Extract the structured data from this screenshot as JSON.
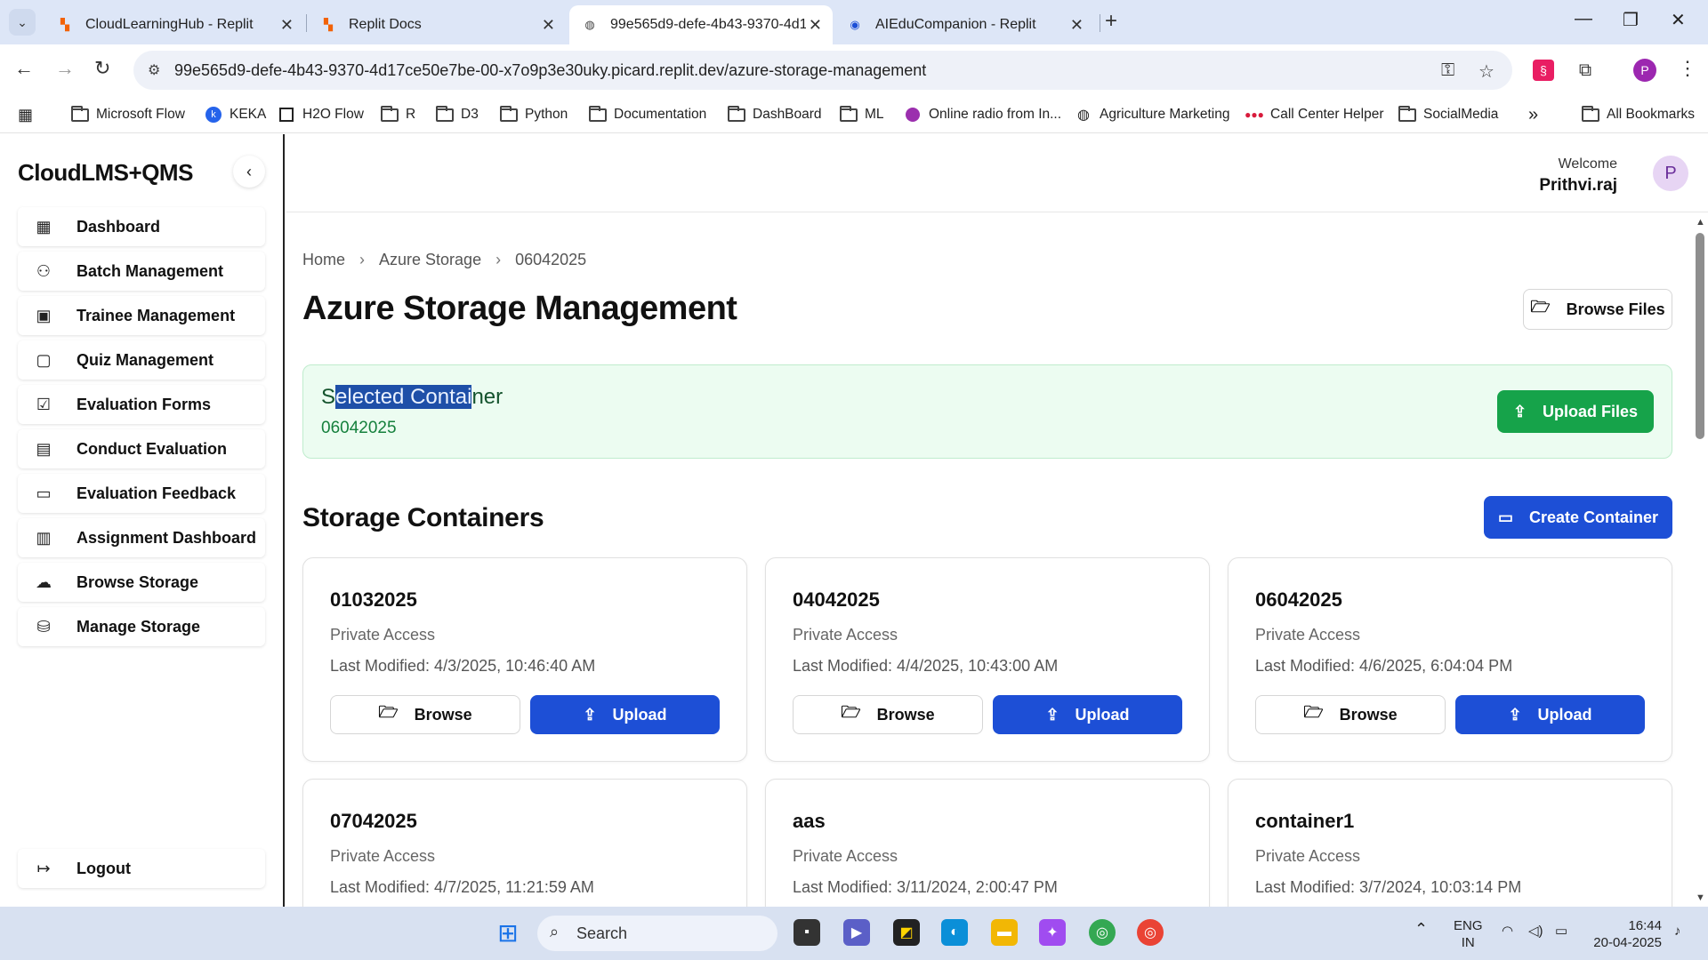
{
  "browser": {
    "tabs": [
      {
        "title": "CloudLearningHub - Replit",
        "active": false
      },
      {
        "title": "Replit Docs",
        "active": false
      },
      {
        "title": "99e565d9-defe-4b43-9370-4d1",
        "active": true
      },
      {
        "title": "AIEduCompanion - Replit",
        "active": false
      }
    ],
    "url": "99e565d9-defe-4b43-9370-4d17ce50e7be-00-x7o9p3e30uky.picard.replit.dev/azure-storage-management",
    "profile_initial": "P",
    "bookmarks": [
      {
        "label": "Microsoft Flow",
        "icon": "folder-icon"
      },
      {
        "label": "KEKA",
        "icon": "keka-icon"
      },
      {
        "label": "H2O Flow",
        "icon": "h2o-icon"
      },
      {
        "label": "R",
        "icon": "folder-icon"
      },
      {
        "label": "D3",
        "icon": "folder-icon"
      },
      {
        "label": "Python",
        "icon": "folder-icon"
      },
      {
        "label": "Documentation",
        "icon": "folder-icon"
      },
      {
        "label": "DashBoard",
        "icon": "folder-icon"
      },
      {
        "label": "ML",
        "icon": "folder-icon"
      },
      {
        "label": "Online radio from In...",
        "icon": "radio-icon"
      },
      {
        "label": "Agriculture Marketing",
        "icon": "globe-icon"
      },
      {
        "label": "Call Center Helper",
        "icon": "dots-icon"
      },
      {
        "label": "SocialMedia",
        "icon": "folder-icon"
      }
    ],
    "all_bookmarks": "All Bookmarks",
    "more_bookmarks": "»"
  },
  "app": {
    "brand": "CloudLMS+QMS",
    "collapse_icon": "‹",
    "nav": [
      {
        "label": "Dashboard",
        "icon": "grid-icon",
        "glyph": "▦"
      },
      {
        "label": "Batch Management",
        "icon": "users-icon",
        "glyph": "⚇"
      },
      {
        "label": "Trainee Management",
        "icon": "clipboard-icon",
        "glyph": "▣"
      },
      {
        "label": "Quiz Management",
        "icon": "book-icon",
        "glyph": "▢"
      },
      {
        "label": "Evaluation Forms",
        "icon": "checkbox-icon",
        "glyph": "☑"
      },
      {
        "label": "Conduct Evaluation",
        "icon": "file-icon",
        "glyph": "▤"
      },
      {
        "label": "Evaluation Feedback",
        "icon": "message-icon",
        "glyph": "▭"
      },
      {
        "label": "Assignment Dashboard",
        "icon": "calendar-icon",
        "glyph": "▥"
      },
      {
        "label": "Browse Storage",
        "icon": "cloud-icon",
        "glyph": "☁"
      },
      {
        "label": "Manage Storage",
        "icon": "database-icon",
        "glyph": "⛁"
      }
    ],
    "logout": "Logout",
    "welcome_label": "Welcome",
    "user_name": "Prithvi.raj",
    "user_initial": "P"
  },
  "page": {
    "breadcrumb": [
      "Home",
      "Azure Storage",
      "06042025"
    ],
    "title": "Azure Storage Management",
    "browse_files": "Browse Files",
    "selected_label_pre": "S",
    "selected_label_hl": "elected Contai",
    "selected_label_post": "ner",
    "selected_value": "06042025",
    "upload_files": "Upload Files",
    "section_title": "Storage Containers",
    "create_container": "Create Container",
    "browse_label": "Browse",
    "upload_label": "Upload",
    "containers": [
      {
        "name": "01032025",
        "access": "Private Access",
        "modified": "Last Modified: 4/3/2025, 10:46:40 AM"
      },
      {
        "name": "04042025",
        "access": "Private Access",
        "modified": "Last Modified: 4/4/2025, 10:43:00 AM"
      },
      {
        "name": "06042025",
        "access": "Private Access",
        "modified": "Last Modified: 4/6/2025, 6:04:04 PM"
      },
      {
        "name": "07042025",
        "access": "Private Access",
        "modified": "Last Modified: 4/7/2025, 11:21:59 AM"
      },
      {
        "name": "aas",
        "access": "Private Access",
        "modified": "Last Modified: 3/11/2024, 2:00:47 PM"
      },
      {
        "name": "container1",
        "access": "Private Access",
        "modified": "Last Modified: 3/7/2024, 10:03:14 PM"
      }
    ]
  },
  "taskbar": {
    "search": "Search",
    "lang1": "ENG",
    "lang2": "IN",
    "time": "16:44",
    "date": "20-04-2025"
  },
  "colors": {
    "primary_blue": "#1d4fd6",
    "success_green": "#16a34a",
    "selected_bg": "#ecfcf1"
  }
}
